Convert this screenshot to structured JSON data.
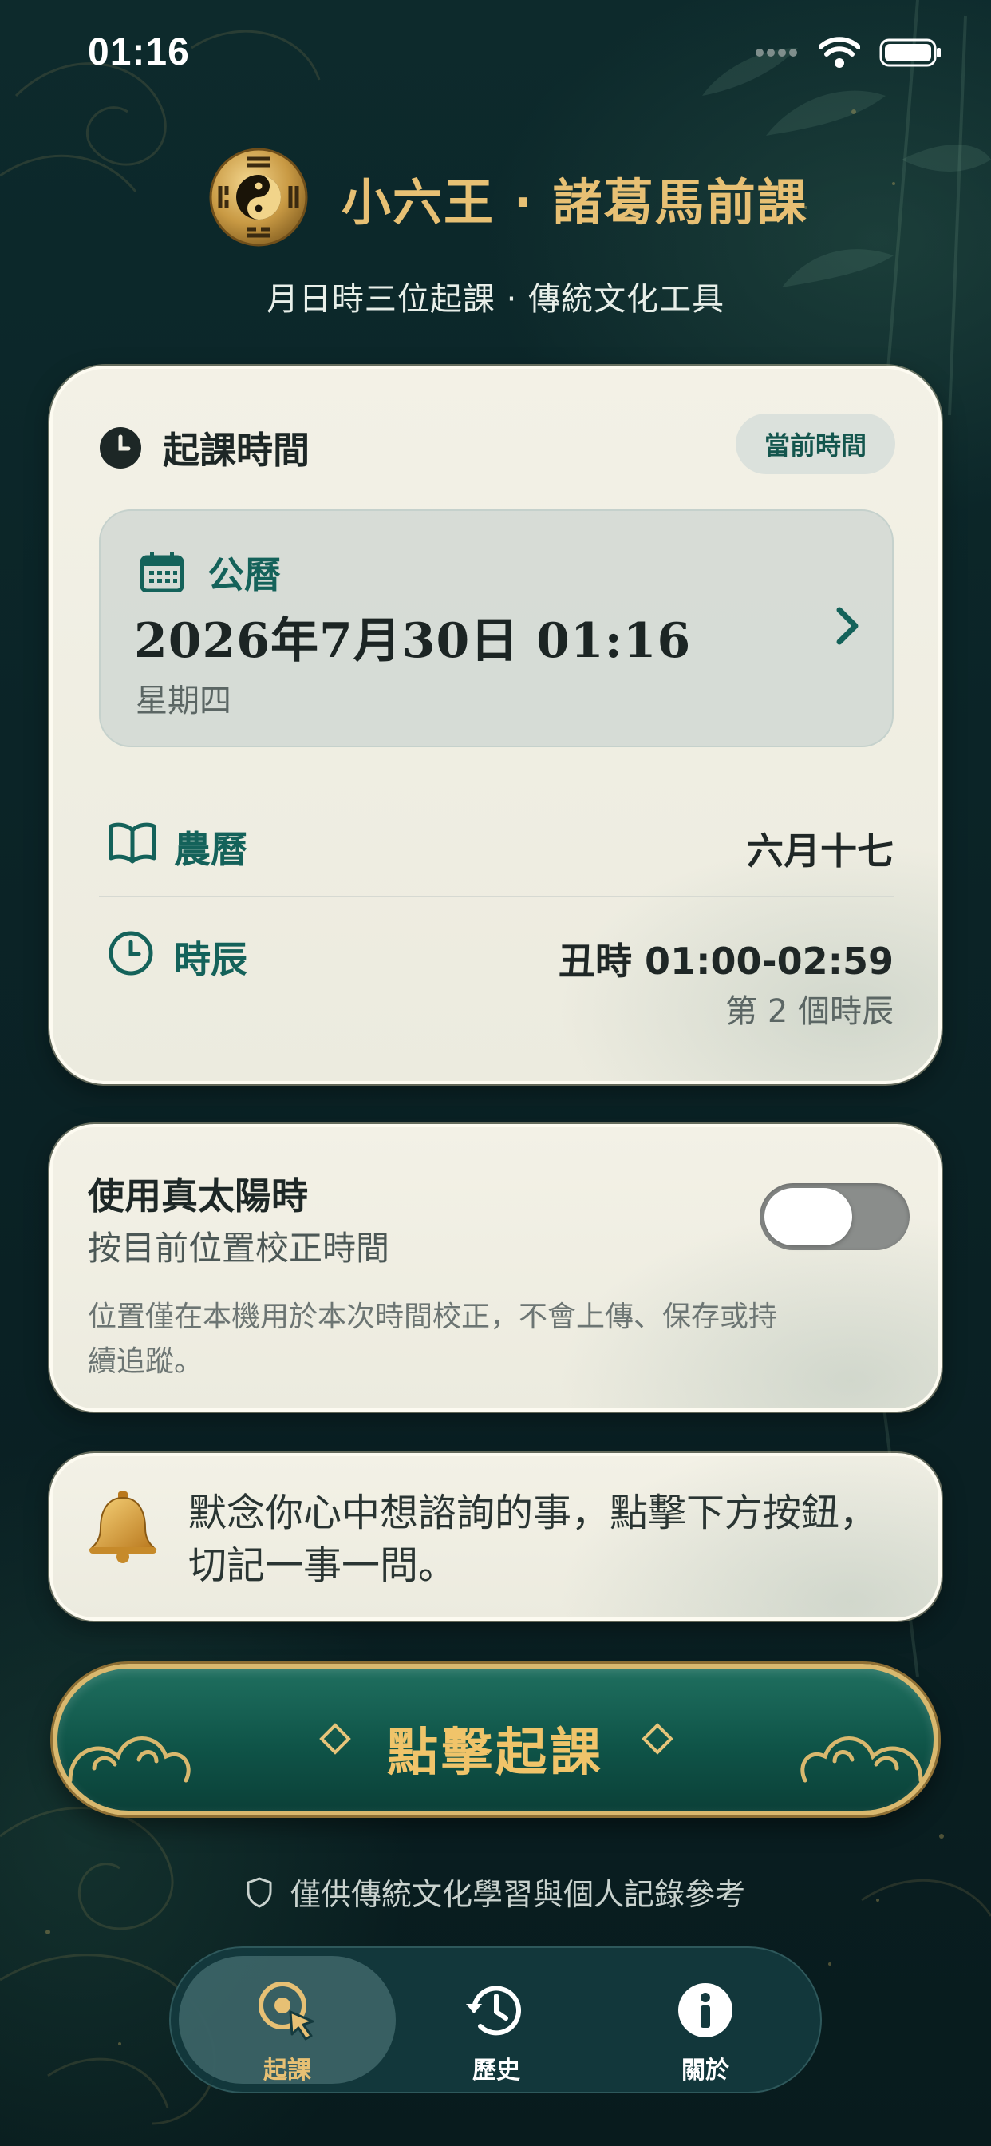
{
  "status_bar": {
    "time": "01:16"
  },
  "header": {
    "title": "小六王 · 諸葛馬前課",
    "subtitle": "月日時三位起課 · 傳統文化工具"
  },
  "time_card": {
    "title": "起課時間",
    "now_button": "當前時間",
    "solar": {
      "label": "公曆",
      "date": "2026年7月30日 01:16",
      "weekday": "星期四"
    },
    "lunar": {
      "label": "農曆",
      "value": "六月十七"
    },
    "hour": {
      "label": "時辰",
      "value": "丑時 01:00-02:59",
      "sub": "第 2 個時辰"
    }
  },
  "true_solar": {
    "title": "使用真太陽時",
    "subtitle": "按目前位置校正時間",
    "note": "位置僅在本機用於本次時間校正，不會上傳、保存或持續追蹤。",
    "enabled": false
  },
  "tip": {
    "text": "默念你心中想諮詢的事，點擊下方按鈕，切記一事一問。"
  },
  "divine_button": {
    "label": "點擊起課"
  },
  "disclaimer": "僅供傳統文化學習與個人記錄參考",
  "tabs": [
    {
      "label": "起課",
      "icon": "divine-cursor-icon",
      "active": true
    },
    {
      "label": "歷史",
      "icon": "history-clock-icon",
      "active": false
    },
    {
      "label": "關於",
      "icon": "info-icon",
      "active": false
    }
  ],
  "colors": {
    "background": "#0b2427",
    "gold": "#e7c074",
    "teal": "#14625a",
    "card": "#f1efe4"
  }
}
